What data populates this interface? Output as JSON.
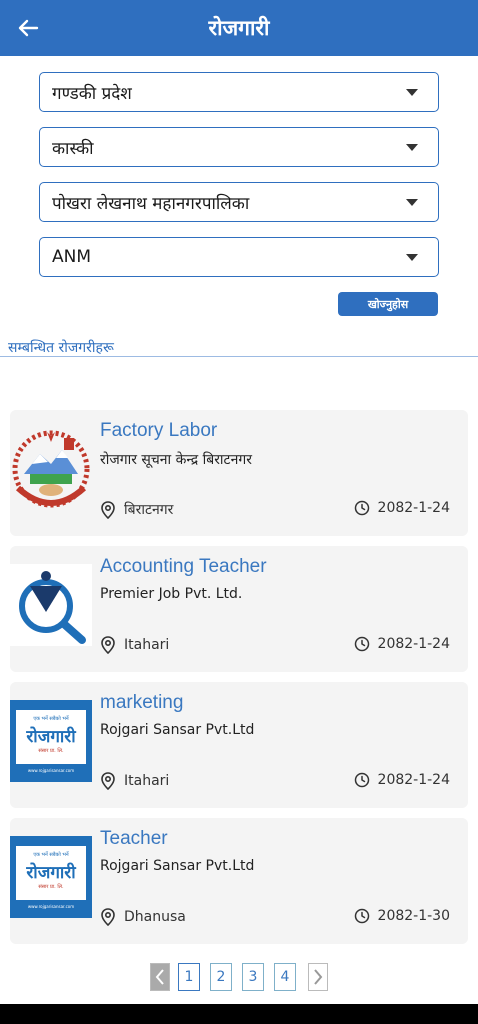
{
  "header": {
    "title": "रोजगारी"
  },
  "filters": {
    "province": "गण्डकी प्रदेश",
    "district": "कास्की",
    "municipality": "पोखरा लेखनाथ महानगरपालिका",
    "category": "ANM",
    "search_label": "खोज्नुहोस"
  },
  "section_label": "सम्बन्धित रोजगरीहरू",
  "jobs": [
    {
      "title": "Factory Labor",
      "company": "रोजगार सूचना केन्द्र बिराटनगर",
      "location": "बिराटनगर",
      "date": "2082-1-24"
    },
    {
      "title": "Accounting Teacher",
      "company": "Premier Job Pvt. Ltd.",
      "location": "Itahari",
      "date": "2082-1-24"
    },
    {
      "title": "marketing",
      "company": "Rojgari Sansar Pvt.Ltd",
      "location": "Itahari",
      "date": "2082-1-24"
    },
    {
      "title": "Teacher",
      "company": "Rojgari Sansar Pvt.Ltd",
      "location": "Dhanusa",
      "date": "2082-1-30"
    }
  ],
  "logos": {
    "rojgari_sansar": {
      "main": "रोजगारी",
      "top": "एक भर्ने सबैको भर्ने",
      "bottom": "संसार प्रा. लि.",
      "url": "www.rojgarisansar.com"
    }
  },
  "pagination": {
    "pages": [
      "1",
      "2",
      "3",
      "4"
    ],
    "current": "1"
  },
  "colors": {
    "primary": "#2f6fbf",
    "title_blue": "#3a78c0",
    "card_bg": "#f4f4f4"
  }
}
